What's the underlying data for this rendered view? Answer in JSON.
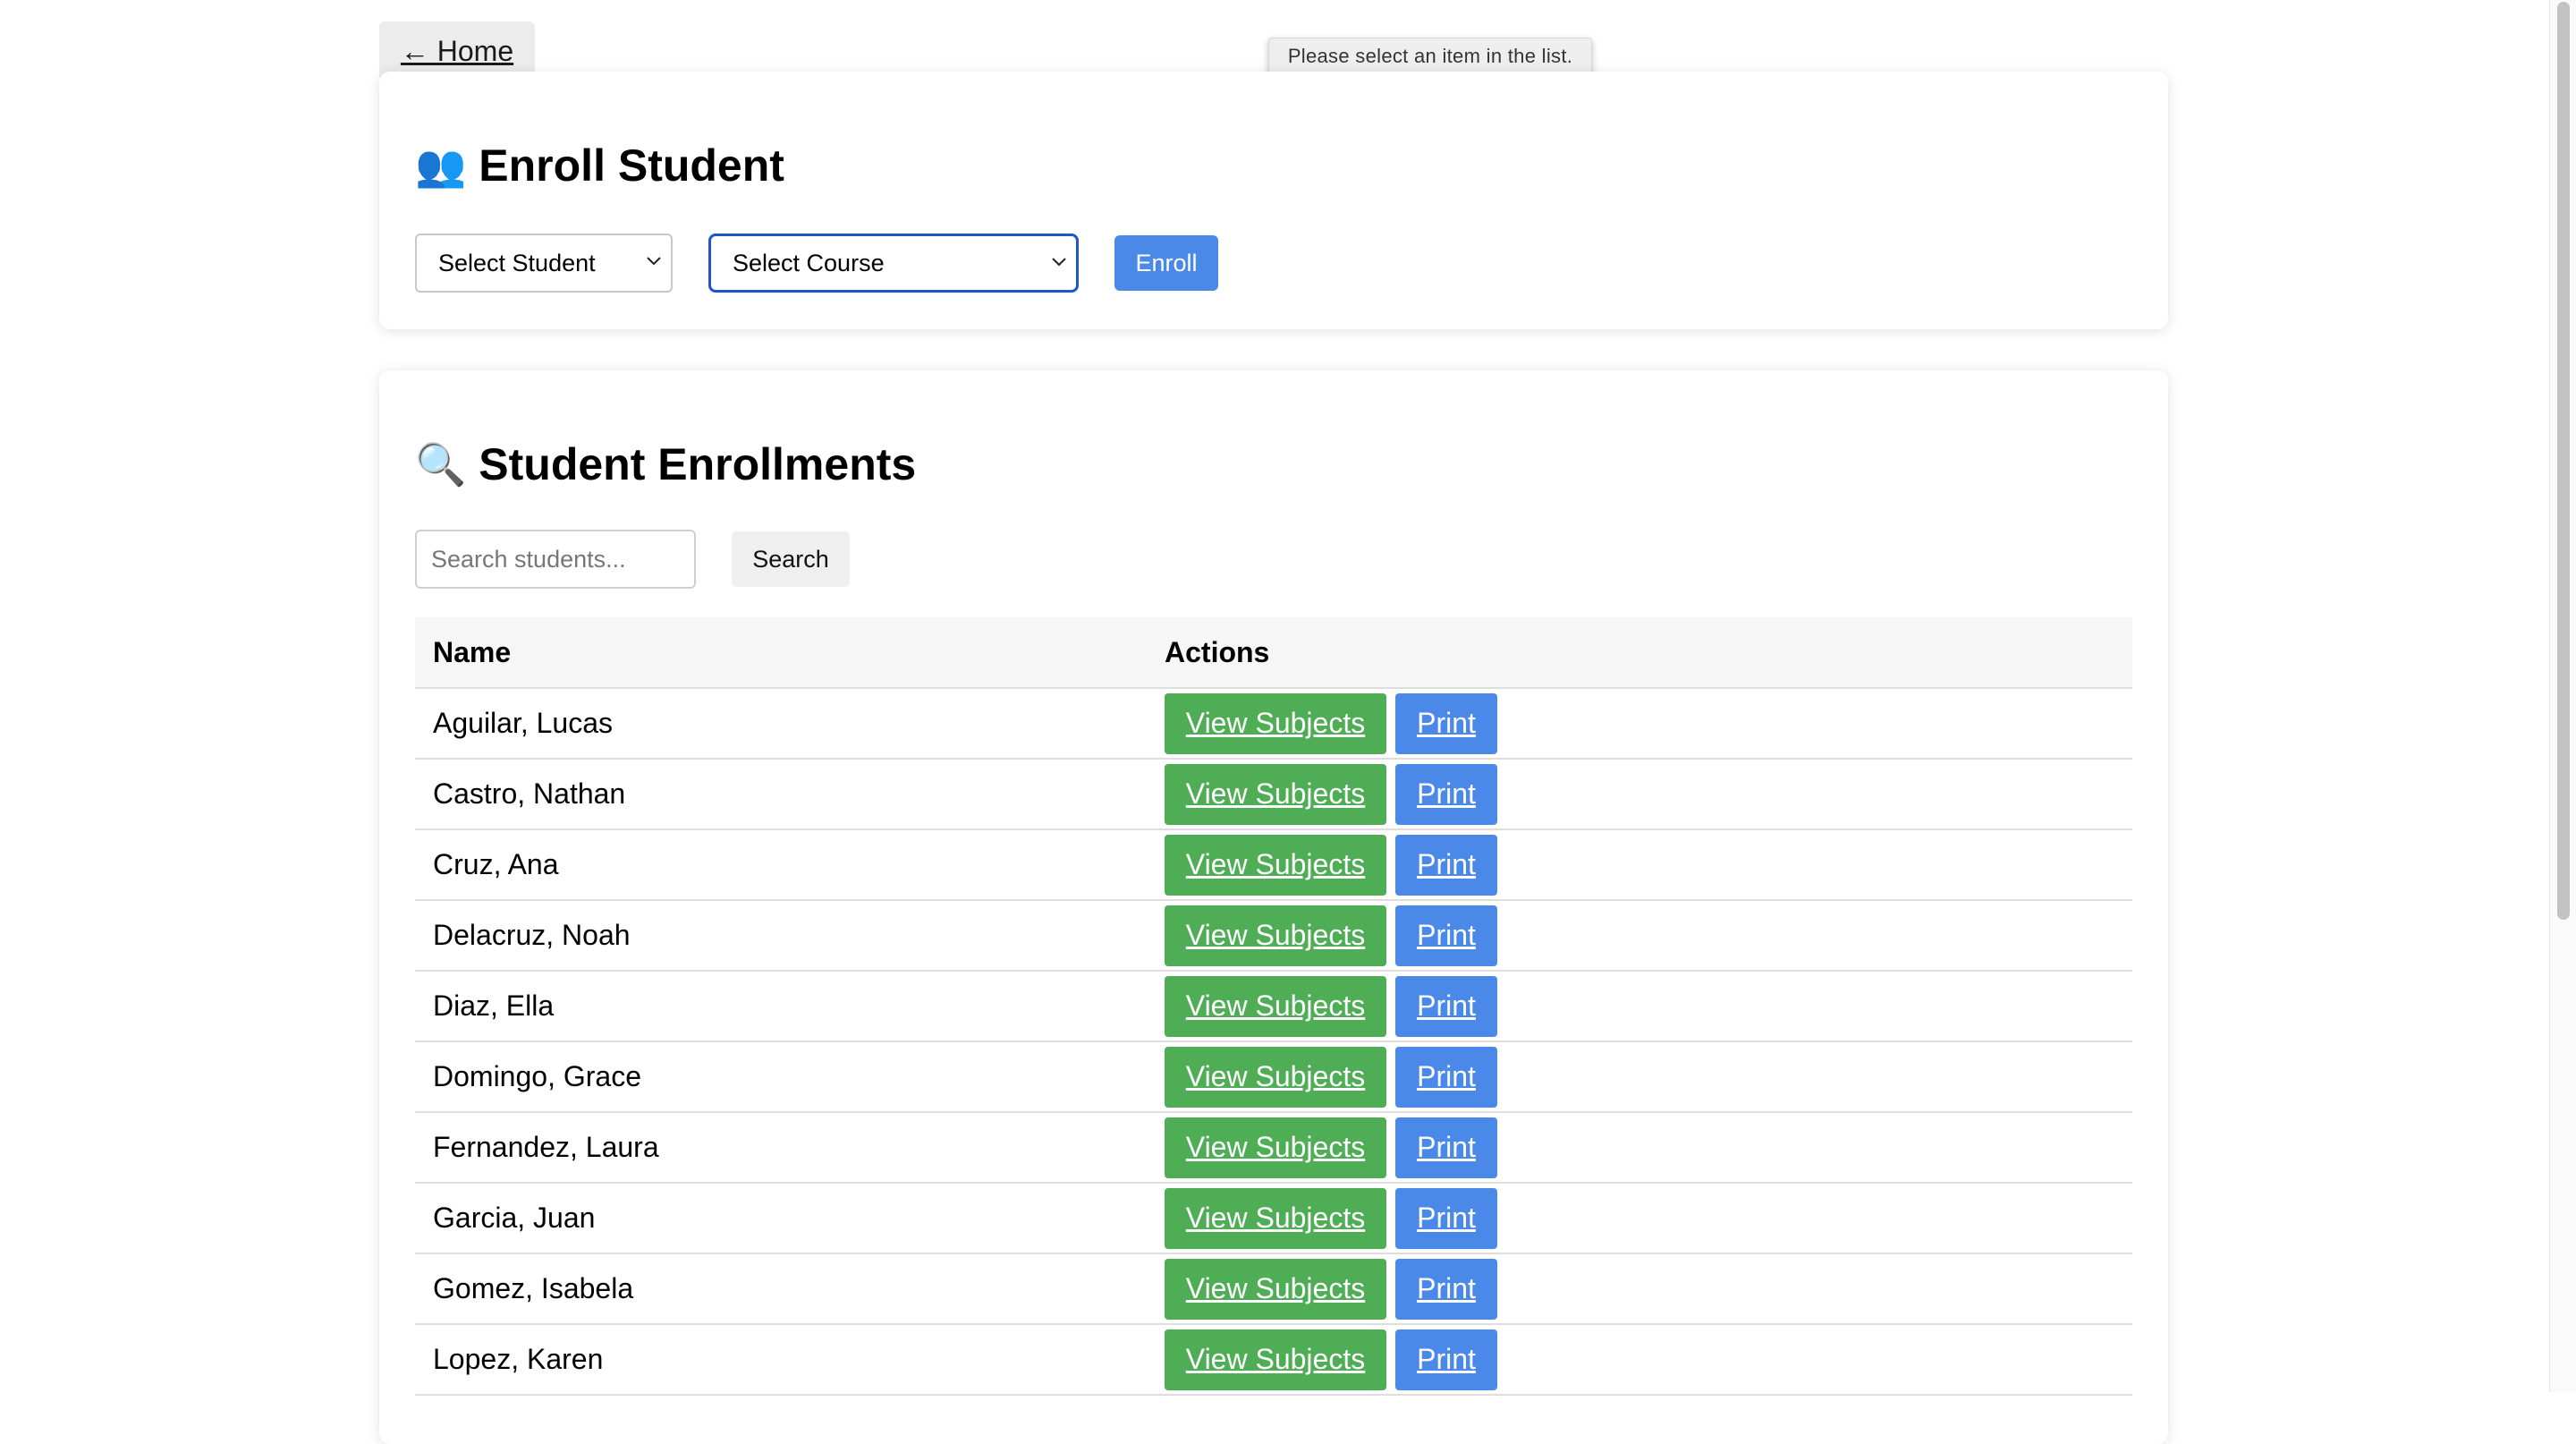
{
  "nav": {
    "home_label": "← Home"
  },
  "tooltip": {
    "text": "Please select an item in the list."
  },
  "enroll": {
    "icon": "👥",
    "title": "Enroll Student",
    "student_select_value": "Select Student",
    "course_select_value": "Select Course",
    "enroll_button": "Enroll"
  },
  "enrollments": {
    "icon": "🔍",
    "title": "Student Enrollments",
    "search_placeholder": "Search students...",
    "search_button": "Search",
    "columns": [
      "Name",
      "Actions"
    ],
    "view_label": "View Subjects",
    "print_label": "Print",
    "rows": [
      "Aguilar, Lucas",
      "Castro, Nathan",
      "Cruz, Ana",
      "Delacruz, Noah",
      "Diaz, Ella",
      "Domingo, Grace",
      "Fernandez, Laura",
      "Garcia, Juan",
      "Gomez, Isabela",
      "Lopez, Karen"
    ]
  },
  "colors": {
    "primary_blue": "#4a89e8",
    "view_green": "#4fad56",
    "focus_border": "#1f57c8"
  }
}
